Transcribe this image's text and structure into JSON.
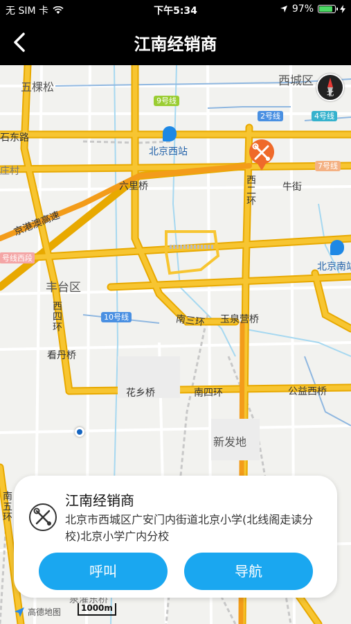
{
  "status": {
    "carrier": "无 SIM 卡",
    "time": "下午5:34",
    "battery_percent": "97%",
    "battery_level": 0.97
  },
  "nav": {
    "title": "江南经销商",
    "back_icon": "chevron-left-icon"
  },
  "map": {
    "labels": {
      "wukesong": "五棵松",
      "xichengqu": "西城区",
      "shidonglu": "石东路",
      "zhuangcun": "庄村",
      "beijingxizhan": "北京西站",
      "liuliqiao": "六里桥",
      "xierhuan": "西二环",
      "niujie": "牛街",
      "jinggang": "京港澳高速",
      "beijingnan": "北京南站",
      "line_duan": "号线西段",
      "fengtaiqu": "丰台区",
      "xisihuan": "西四环",
      "nansanhuan": "南三环",
      "yuquanying": "玉泉营桥",
      "kandanqiao": "看丹桥",
      "huaxiangqiao": "花乡桥",
      "nansihuan": "南四环",
      "gongyixiqiao": "公益西桥",
      "xinfadi": "新发地",
      "nanwuhuan": "南五环",
      "bottom_bridge": "泉灌东桥"
    },
    "lines": {
      "line9": "9号线",
      "line2": "2号线",
      "line4": "4号线",
      "line7": "7号线",
      "line10": "10号线"
    },
    "compass_label": "北",
    "logo": "高德地图",
    "scale": "1000m",
    "colors": {
      "road_major": "#f7c531",
      "road_outline": "#e8a900",
      "highway": "#f39c1a",
      "water": "#a6d8f0",
      "subway": "#8fb7e0",
      "marker": "#ef6a2a"
    }
  },
  "card": {
    "title": "江南经销商",
    "address": "北京市西城区广安门内街道北京小学(北线阁走读分校)北京小学广内分校",
    "call_label": "呼叫",
    "navigate_label": "导航",
    "icon": "wrench-screwdriver-icon"
  }
}
